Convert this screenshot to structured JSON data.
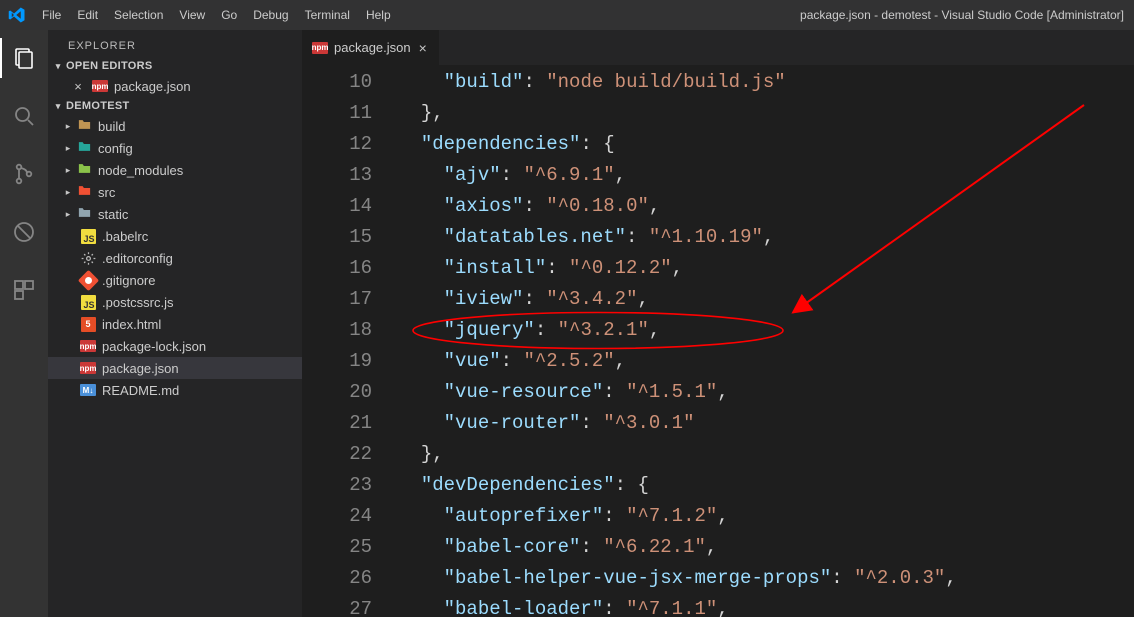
{
  "titlebar": {
    "menus": [
      "File",
      "Edit",
      "Selection",
      "View",
      "Go",
      "Debug",
      "Terminal",
      "Help"
    ],
    "title": "package.json - demotest - Visual Studio Code [Administrator]"
  },
  "sidebar": {
    "title": "EXPLORER",
    "sections": {
      "openEditors": {
        "label": "OPEN EDITORS"
      },
      "folder": {
        "label": "DEMOTEST"
      }
    },
    "openEditorItems": [
      {
        "label": "package.json",
        "icon": "npm",
        "dirty": false
      }
    ],
    "tree": [
      {
        "label": "build",
        "icon": "folder-yellow",
        "depth": 0,
        "expandable": true
      },
      {
        "label": "config",
        "icon": "folder-teal",
        "depth": 0,
        "expandable": true
      },
      {
        "label": "node_modules",
        "icon": "folder-green",
        "depth": 0,
        "expandable": true
      },
      {
        "label": "src",
        "icon": "folder-vue",
        "depth": 0,
        "expandable": true
      },
      {
        "label": "static",
        "icon": "folder-plain",
        "depth": 0,
        "expandable": true
      },
      {
        "label": ".babelrc",
        "icon": "js",
        "depth": 1,
        "expandable": false
      },
      {
        "label": ".editorconfig",
        "icon": "cfg",
        "depth": 1,
        "expandable": false
      },
      {
        "label": ".gitignore",
        "icon": "git",
        "depth": 1,
        "expandable": false
      },
      {
        "label": ".postcssrc.js",
        "icon": "js",
        "depth": 1,
        "expandable": false
      },
      {
        "label": "index.html",
        "icon": "html",
        "depth": 1,
        "expandable": false
      },
      {
        "label": "package-lock.json",
        "icon": "npm",
        "depth": 1,
        "expandable": false
      },
      {
        "label": "package.json",
        "icon": "npm",
        "depth": 1,
        "expandable": false,
        "selected": true
      },
      {
        "label": "README.md",
        "icon": "md",
        "depth": 1,
        "expandable": false
      }
    ]
  },
  "tab": {
    "label": "package.json"
  },
  "code": {
    "startLine": 10,
    "lines": [
      {
        "indent": 4,
        "key": "build",
        "val": "node build/build.js",
        "trail": "",
        "prefixClose": false
      },
      {
        "closeBrace": 2,
        "trailComma": true
      },
      {
        "indent": 2,
        "key": "dependencies",
        "openBrace": true
      },
      {
        "indent": 4,
        "key": "ajv",
        "val": "^6.9.1",
        "trail": ","
      },
      {
        "indent": 4,
        "key": "axios",
        "val": "^0.18.0",
        "trail": ","
      },
      {
        "indent": 4,
        "key": "datatables.net",
        "val": "^1.10.19",
        "trail": ","
      },
      {
        "indent": 4,
        "key": "install",
        "val": "^0.12.2",
        "trail": ","
      },
      {
        "indent": 4,
        "key": "iview",
        "val": "^3.4.2",
        "trail": ","
      },
      {
        "indent": 4,
        "key": "jquery",
        "val": "^3.2.1",
        "trail": ","
      },
      {
        "indent": 4,
        "key": "vue",
        "val": "^2.5.2",
        "trail": ","
      },
      {
        "indent": 4,
        "key": "vue-resource",
        "val": "^1.5.1",
        "trail": ","
      },
      {
        "indent": 4,
        "key": "vue-router",
        "val": "^3.0.1",
        "trail": ""
      },
      {
        "closeBrace": 2,
        "trailComma": true
      },
      {
        "indent": 2,
        "key": "devDependencies",
        "openBrace": true
      },
      {
        "indent": 4,
        "key": "autoprefixer",
        "val": "^7.1.2",
        "trail": ","
      },
      {
        "indent": 4,
        "key": "babel-core",
        "val": "^6.22.1",
        "trail": ","
      },
      {
        "indent": 4,
        "key": "babel-helper-vue-jsx-merge-props",
        "val": "^2.0.3",
        "trail": ","
      },
      {
        "indent": 4,
        "key": "babel-loader",
        "val": "^7.1.1",
        "trail": ","
      }
    ]
  },
  "annotation": {
    "circled_line_index": 8,
    "arrow": true
  }
}
